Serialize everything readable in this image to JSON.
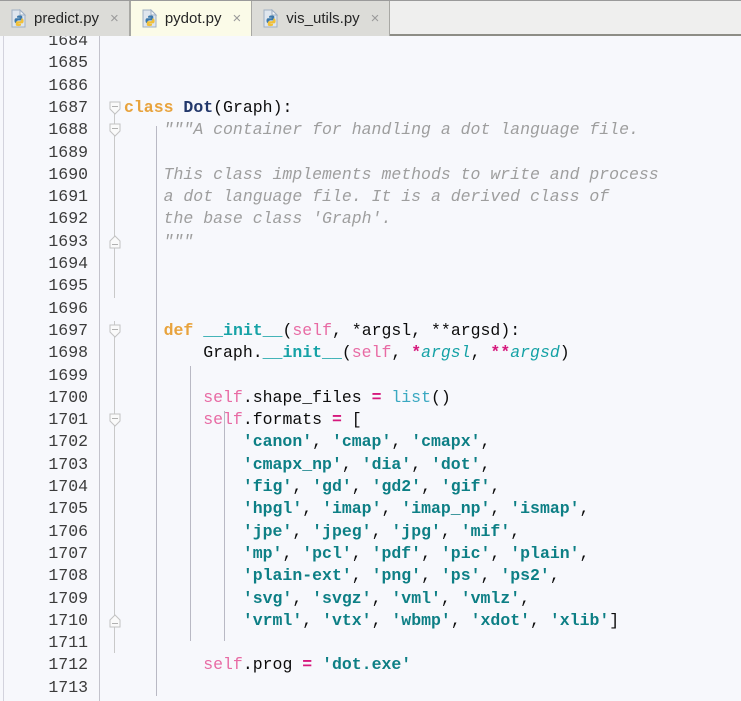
{
  "window": {
    "kind": "python-code-editor",
    "colors": {
      "editor_background": "#f7f8fc",
      "tabbar_background": "#efefee",
      "active_tab_background": "#fbfbe8",
      "inactive_tab_background": "#dcdcd8",
      "gutter_text": "#3b3b3b",
      "keyword": "#e8a33d",
      "class_name": "#23386b",
      "docstring": "#9e9e9e",
      "function": "#16a2a6",
      "self": "#e86ba4",
      "operator": "#d6197d",
      "builtin": "#3aa8c1",
      "string": "#0d7f85"
    }
  },
  "tabbar": {
    "tabs": [
      {
        "label": "predict.py",
        "icon": "python-file-icon",
        "close": "×",
        "active": false
      },
      {
        "label": "pydot.py",
        "icon": "python-file-icon",
        "close": "×",
        "active": true
      },
      {
        "label": "vis_utils.py",
        "icon": "python-file-icon",
        "close": "×",
        "active": false
      }
    ]
  },
  "editor": {
    "first_line_number": 1684,
    "last_line_number": 1713,
    "language": "Python",
    "lines": [
      {
        "n": 1684,
        "text": ""
      },
      {
        "n": 1685,
        "text": ""
      },
      {
        "n": 1686,
        "text": ""
      },
      {
        "n": 1687,
        "text": "class Dot(Graph):"
      },
      {
        "n": 1688,
        "text": "    \"\"\"A container for handling a dot language file."
      },
      {
        "n": 1689,
        "text": ""
      },
      {
        "n": 1690,
        "text": "    This class implements methods to write and process"
      },
      {
        "n": 1691,
        "text": "    a dot language file. It is a derived class of"
      },
      {
        "n": 1692,
        "text": "    the base class 'Graph'."
      },
      {
        "n": 1693,
        "text": "    \"\"\""
      },
      {
        "n": 1694,
        "text": ""
      },
      {
        "n": 1695,
        "text": ""
      },
      {
        "n": 1696,
        "text": ""
      },
      {
        "n": 1697,
        "text": "    def __init__(self, *argsl, **argsd):"
      },
      {
        "n": 1698,
        "text": "        Graph.__init__(self, *argsl, **argsd)"
      },
      {
        "n": 1699,
        "text": ""
      },
      {
        "n": 1700,
        "text": "        self.shape_files = list()"
      },
      {
        "n": 1701,
        "text": "        self.formats = ["
      },
      {
        "n": 1702,
        "text": "            'canon', 'cmap', 'cmapx',"
      },
      {
        "n": 1703,
        "text": "            'cmapx_np', 'dia', 'dot',"
      },
      {
        "n": 1704,
        "text": "            'fig', 'gd', 'gd2', 'gif',"
      },
      {
        "n": 1705,
        "text": "            'hpgl', 'imap', 'imap_np', 'ismap',"
      },
      {
        "n": 1706,
        "text": "            'jpe', 'jpeg', 'jpg', 'mif',"
      },
      {
        "n": 1707,
        "text": "            'mp', 'pcl', 'pdf', 'pic', 'plain',"
      },
      {
        "n": 1708,
        "text": "            'plain-ext', 'png', 'ps', 'ps2',"
      },
      {
        "n": 1709,
        "text": "            'svg', 'svgz', 'vml', 'vmlz',"
      },
      {
        "n": 1710,
        "text": "            'vrml', 'vtx', 'wbmp', 'xdot', 'xlib']"
      },
      {
        "n": 1711,
        "text": ""
      },
      {
        "n": 1712,
        "text": "        self.prog = 'dot.exe'"
      },
      {
        "n": 1713,
        "text": ""
      }
    ],
    "fold_markers": [
      {
        "line": 1687,
        "state": "expanded"
      },
      {
        "line": 1688,
        "state": "expanded"
      },
      {
        "line": 1693,
        "state": "collapsed-end"
      },
      {
        "line": 1697,
        "state": "expanded"
      },
      {
        "line": 1701,
        "state": "expanded"
      },
      {
        "line": 1710,
        "state": "collapsed-end"
      }
    ]
  }
}
